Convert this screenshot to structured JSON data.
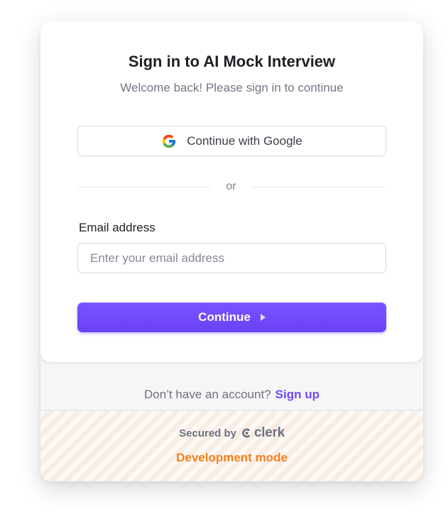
{
  "header": {
    "title": "Sign in to AI Mock Interview",
    "subtitle": "Welcome back! Please sign in to continue"
  },
  "social": {
    "google_label": "Continue with Google",
    "icon": "google-icon"
  },
  "divider": {
    "text": "or"
  },
  "form": {
    "email_label": "Email address",
    "email_value": "",
    "email_placeholder": "Enter your email address",
    "continue_label": "Continue",
    "continue_icon": "caret-right-icon"
  },
  "footer": {
    "signup_prompt": "Don’t have an account?",
    "signup_link": "Sign up",
    "secured_by": "Secured by",
    "brand": "clerk",
    "dev_mode": "Development mode"
  },
  "colors": {
    "primary": "#6c47ff",
    "dev_mode": "#f37f1e",
    "text": "#1f1f24",
    "muted": "#747686"
  }
}
